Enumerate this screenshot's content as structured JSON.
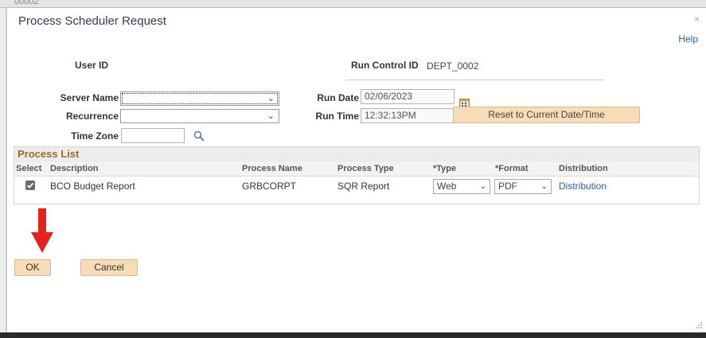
{
  "background": {
    "ghost_text": "00002"
  },
  "dialog": {
    "title": "Process Scheduler Request",
    "close_symbol": "×",
    "help_label": "Help"
  },
  "header": {
    "user_id_label": "User ID",
    "user_id_value": "",
    "run_control_label": "Run Control ID",
    "run_control_value": "DEPT_0002"
  },
  "fields": {
    "server_name_label": "Server Name",
    "server_name_value": "",
    "recurrence_label": "Recurrence",
    "recurrence_value": "",
    "time_zone_label": "Time Zone",
    "time_zone_value": "",
    "run_date_label": "Run Date",
    "run_date_value": "02/06/2023",
    "run_time_label": "Run Time",
    "run_time_value": "12:32:13PM",
    "reset_button_label": "Reset to Current Date/Time"
  },
  "process_list": {
    "title": "Process List",
    "columns": [
      "Select",
      "Description",
      "Process Name",
      "Process Type",
      "*Type",
      "*Format",
      "Distribution"
    ],
    "rows": [
      {
        "selected": true,
        "description": "BCO Budget Report",
        "process_name": "GRBCORPT",
        "process_type": "SQR Report",
        "type": "Web",
        "format": "PDF",
        "distribution": "Distribution"
      }
    ]
  },
  "actions": {
    "ok_label": "OK",
    "cancel_label": "Cancel"
  },
  "icons": {
    "lookup": "magnifier-icon",
    "calendar": "calendar-icon",
    "annotation_arrow": "red-down-arrow-icon",
    "chevron": "chevron-down-icon"
  },
  "colors": {
    "button_bg": "#f6dcb7",
    "section_title": "#a46a1f",
    "link": "#2b5f9e",
    "arrow": "#e5221c"
  }
}
